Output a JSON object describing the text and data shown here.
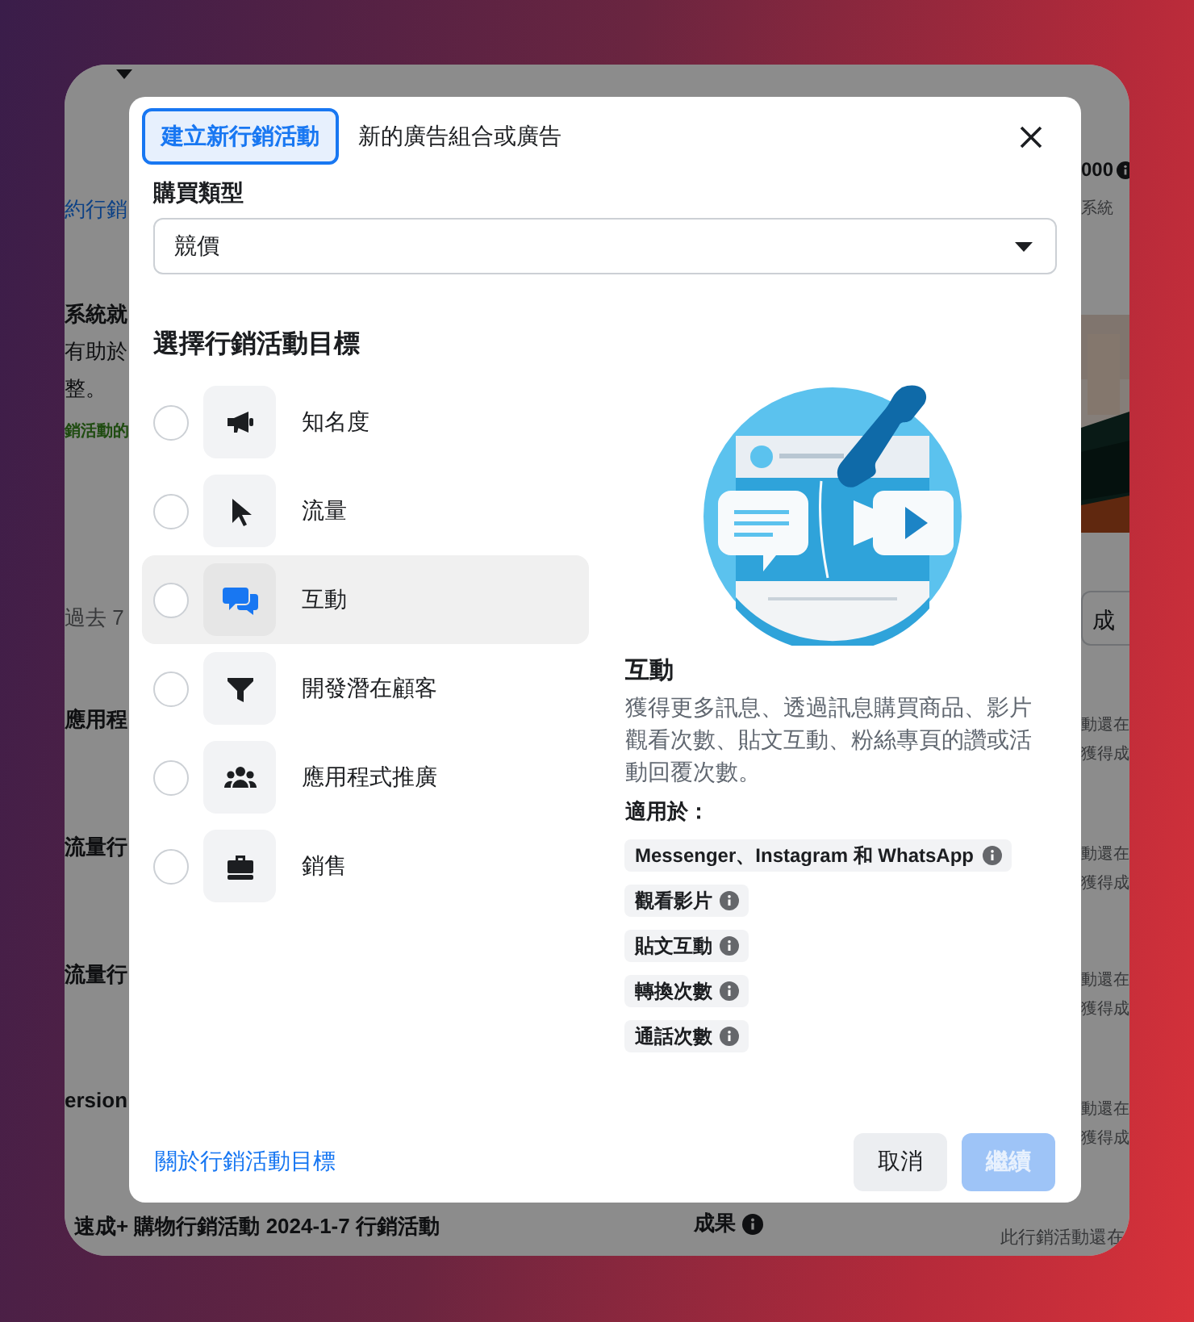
{
  "background": {
    "left_texts": [
      {
        "text": "約行銷",
        "kind": "link"
      },
      {
        "text": "系統就",
        "kind": "bold"
      },
      {
        "text": "有助於",
        "kind": "plain"
      },
      {
        "text": "整。",
        "kind": "plain"
      },
      {
        "text": "銷活動的",
        "kind": "note"
      },
      {
        "text": "過去 7",
        "kind": "muted"
      },
      {
        "text": "應用程",
        "kind": "bold"
      },
      {
        "text": "流量行",
        "kind": "bold"
      },
      {
        "text": "流量行",
        "kind": "bold"
      },
      {
        "text": "ersion",
        "kind": "bold"
      }
    ],
    "right_items": [
      {
        "text": "000",
        "kind": "amount"
      },
      {
        "text": "系統",
        "kind": "muted"
      },
      {
        "kind": "picture"
      },
      {
        "text": "成",
        "kind": "button"
      },
      {
        "text": "動還在",
        "kind": "muted"
      },
      {
        "text": "獲得成",
        "kind": "muted"
      },
      {
        "text": "動還在",
        "kind": "muted"
      },
      {
        "text": "獲得成",
        "kind": "muted"
      },
      {
        "text": "動還在",
        "kind": "muted"
      },
      {
        "text": "獲得成",
        "kind": "muted"
      },
      {
        "text": "動還在",
        "kind": "muted"
      },
      {
        "text": "獲得成",
        "kind": "muted"
      }
    ],
    "bottom": {
      "campaign": "速成+ 購物行銷活動 2024-1-7 行銷活動",
      "results": "成果",
      "note": "此行銷活動還在"
    }
  },
  "dialog": {
    "tabs": [
      {
        "label": "建立新行銷活動",
        "selected": true
      },
      {
        "label": "新的廣告組合或廣告",
        "selected": false
      }
    ],
    "buying_type": {
      "label": "購買類型",
      "value": "競價"
    },
    "objective_heading": "選擇行銷活動目標",
    "objectives": [
      {
        "label": "知名度",
        "selected": false,
        "highlighted": false
      },
      {
        "label": "流量",
        "selected": false,
        "highlighted": false
      },
      {
        "label": "互動",
        "selected": false,
        "highlighted": true
      },
      {
        "label": "開發潛在顧客",
        "selected": false,
        "highlighted": false
      },
      {
        "label": "應用程式推廣",
        "selected": false,
        "highlighted": false
      },
      {
        "label": "銷售",
        "selected": false,
        "highlighted": false
      }
    ],
    "detail": {
      "title": "互動",
      "description": "獲得更多訊息、透過訊息購買商品、影片觀看次數、貼文互動、粉絲專頁的讚或活動回覆次數。",
      "applies_label": "適用於：",
      "chips": [
        "Messenger、Instagram 和 WhatsApp",
        "觀看影片",
        "貼文互動",
        "轉換次數",
        "通話次數"
      ]
    },
    "footer": {
      "link": "關於行銷活動目標",
      "cancel": "取消",
      "continue": {
        "label": "繼續",
        "disabled": true
      }
    }
  }
}
